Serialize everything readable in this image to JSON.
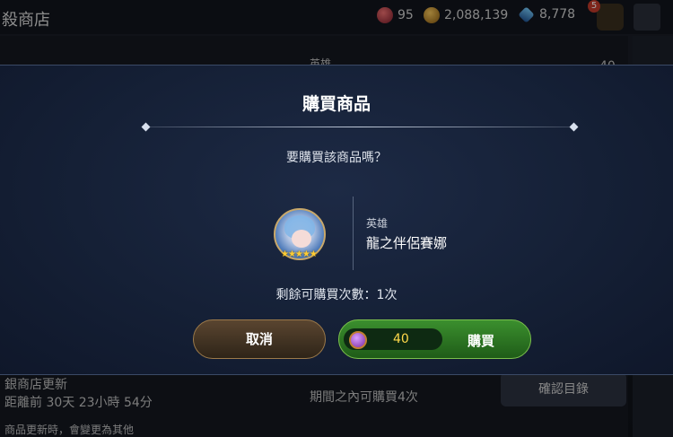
{
  "background": {
    "shop_title": "殺商店",
    "currencies": [
      {
        "icon": "ruby-icon",
        "value": "95"
      },
      {
        "icon": "gold-coin-icon",
        "value": "2,088,139"
      },
      {
        "icon": "crystal-icon",
        "value": "8,778"
      }
    ],
    "notification_count": "5",
    "list_items": [
      {
        "label": "英雄"
      },
      {
        "label": "40"
      }
    ],
    "refresh_label": "銀商店更新",
    "refresh_time": "距離前 30天 23小時 54分",
    "limit_text": "期間之內可購買4次",
    "footer_note": "商品更新時，會變更為其他",
    "confirm_catalog_label": "確認目錄",
    "colors": {
      "accent": "#c9a86a"
    }
  },
  "modal": {
    "title": "購買商品",
    "question": "要購買該商品嗎？",
    "item": {
      "type": "英雄",
      "name": "龍之伴侶賽娜",
      "stars": "★★★★★",
      "stars_count": 5
    },
    "remaining": "剩餘可購買次數：1次",
    "cancel_label": "取消",
    "price": "40",
    "price_icon": "ruby-icon",
    "buy_label": "購買",
    "colors": {
      "buy_button": "#2f7a24",
      "cancel_button": "#4a3826",
      "price_text": "#ffd84a"
    }
  }
}
